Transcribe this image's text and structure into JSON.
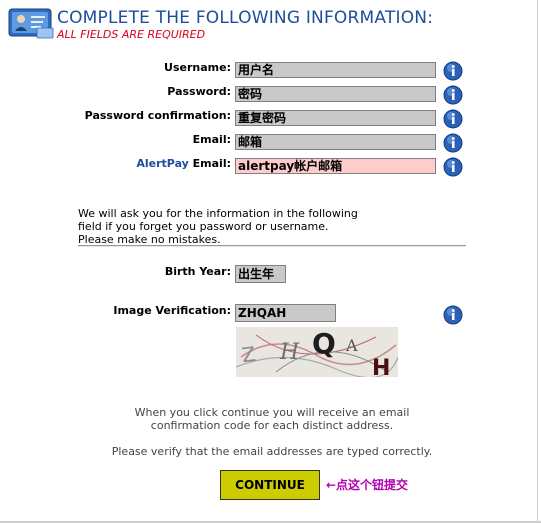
{
  "header": {
    "title": "COMPLETE THE FOLLOWING INFORMATION:",
    "subtitle": "ALL FIELDS ARE REQUIRED"
  },
  "form": {
    "username": {
      "label": "Username:",
      "value": "用户名"
    },
    "password": {
      "label": "Password:",
      "value": "密码"
    },
    "password_confirmation": {
      "label": "Password confirmation:",
      "value": "重复密码"
    },
    "email": {
      "label": "Email:",
      "value": "邮箱"
    },
    "alertpay_email": {
      "label_brand": "AlertPay",
      "label_rest": " Email:",
      "value": "alertpay帐户邮箱"
    },
    "note_lines": [
      "We will ask you for the information in the following",
      "field if you forget you password or username.",
      "Please make no mistakes."
    ],
    "birth_year": {
      "label": "Birth Year:",
      "value": "出生年"
    },
    "image_verification": {
      "label": "Image Verification:",
      "value": "ZHQAH"
    }
  },
  "captcha": {
    "letters": [
      "Z",
      "H",
      "Q",
      "A",
      "H"
    ]
  },
  "footer": {
    "info_lines": [
      "When you click continue you will receive an email",
      "confirmation code for each distinct address."
    ],
    "verify_line": "Please verify that the email addresses are typed correctly.",
    "continue_label": "CONTINUE",
    "annotation": "←点这个钮提交"
  },
  "colors": {
    "title": "#1e4d9b",
    "required": "#d8001a",
    "field_bg": "#c9c9c9",
    "alertpay_field_bg": "#ffcccc",
    "button_bg": "#cccc00",
    "annotation": "#b000b0"
  },
  "icons": {
    "logo": "id-card-logo",
    "info": "info-icon"
  }
}
